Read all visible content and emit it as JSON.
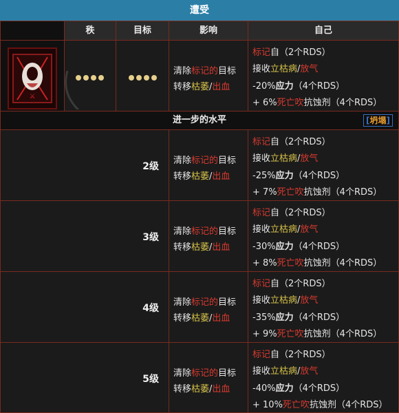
{
  "title": "遭受",
  "header": {
    "rank": "秩",
    "target": "目标",
    "effect": "影响",
    "self": "自己"
  },
  "base": {
    "effect": {
      "line1_a": "清除",
      "line1_b": "标记的",
      "line1_c": "目标",
      "line2_a": "转移",
      "line2_b": "枯萎",
      "line2_sep": "/",
      "line2_c": "出血"
    },
    "self": [
      {
        "a": "标记",
        "b": "自（2个RDS）"
      },
      {
        "a": "接收",
        "b": "立枯病",
        "sep": "/",
        "c": "放气"
      },
      {
        "a": "-20%",
        "b": "应力",
        "c": "（4个RDS）"
      },
      {
        "a": "+ 6%",
        "b": "死亡吹",
        "c": "抗蚀剂（4个RDS）"
      }
    ]
  },
  "sub_header": {
    "label": "进一步的水平",
    "button": "坍塌",
    "bracket_l": "[",
    "bracket_r": "]"
  },
  "levels": [
    {
      "level": "2级",
      "stress": "-25%",
      "resist": "+ 7%"
    },
    {
      "level": "3级",
      "stress": "-30%",
      "resist": "+ 8%"
    },
    {
      "level": "4级",
      "stress": "-35%",
      "resist": "+ 9%"
    },
    {
      "level": "5级",
      "stress": "-40%",
      "resist": "+ 10%"
    }
  ],
  "level_text": {
    "effect_1a": "清除",
    "effect_1b": "标记的",
    "effect_1c": "目标",
    "effect_2a": "转移",
    "effect_2b": "枯萎",
    "effect_2sep": "/",
    "effect_2c": "出血",
    "self_1a": "标记",
    "self_1b": "自（2个RDS）",
    "self_2a": "接收",
    "self_2b": "立枯病",
    "self_2sep": "/",
    "self_2c": "放气",
    "self_3b": "应力",
    "self_3c": "（4个RDS）",
    "self_4b": "死亡吹",
    "self_4c": "抗蚀剂（4个RDS）"
  },
  "colors": {
    "title_bar": "#2b7fa6",
    "border": "#7a2a20",
    "red": "#d83a2f",
    "yellow": "#d6c24a"
  },
  "icons": {
    "skill": "skill-portrait-icon",
    "blade": "scythe-blade-icon"
  }
}
